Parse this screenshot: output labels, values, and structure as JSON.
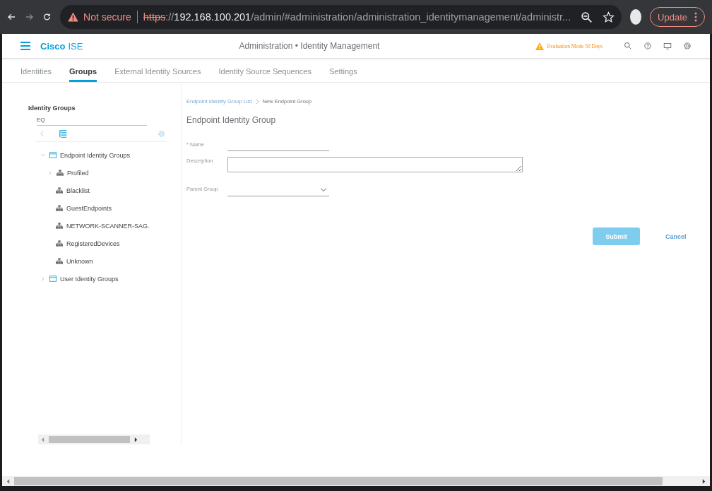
{
  "browser": {
    "security": "Not secure",
    "url_scheme": "https",
    "url_separator": "://",
    "url_host": "192.168.100.201",
    "url_path": "/admin/#administration/administration_identitymanagement/administr...",
    "update": "Update"
  },
  "header": {
    "brand": "Cisco",
    "product": "ISE",
    "title": "Administration • Identity Management",
    "evaluation": "Evaluation Mode 50 Days"
  },
  "tabs": [
    {
      "label": "Identities",
      "selected": false
    },
    {
      "label": "Groups",
      "selected": true
    },
    {
      "label": "External Identity Sources",
      "selected": false
    },
    {
      "label": "Identity Source Sequences",
      "selected": false
    },
    {
      "label": "Settings",
      "selected": false
    }
  ],
  "sidebar": {
    "title": "Identity Groups",
    "search": {
      "value": "EQ"
    },
    "tree": [
      {
        "label": "Endpoint Identity Groups",
        "kind": "folder",
        "expanded": true,
        "children": [
          {
            "label": "Profiled",
            "kind": "group",
            "expanded": false
          },
          {
            "label": "Blacklist",
            "kind": "group"
          },
          {
            "label": "GuestEndpoints",
            "kind": "group"
          },
          {
            "label": "NETWORK-SCANNER-SAG.",
            "kind": "group"
          },
          {
            "label": "RegisteredDevices",
            "kind": "group"
          },
          {
            "label": "Unknown",
            "kind": "group"
          }
        ]
      },
      {
        "label": "User Identity Groups",
        "kind": "folder",
        "expanded": false
      }
    ]
  },
  "breadcrumb": {
    "link": "Endpoint Identity Group List",
    "current": "New Endpoint Group"
  },
  "form": {
    "title": "Endpoint Identity Group",
    "name_label": "* Name",
    "description_label": "Description",
    "parent_label": "Parent Group",
    "submit": "Submit",
    "cancel": "Cancel"
  }
}
